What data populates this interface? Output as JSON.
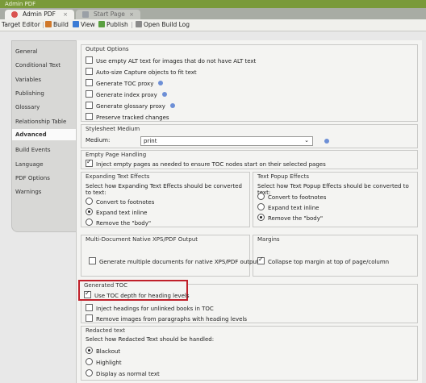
{
  "window": {
    "title": "Admin PDF"
  },
  "tabs": [
    {
      "label": "Admin PDF",
      "close": "×",
      "color": "#d9534f"
    },
    {
      "label": "Start Page",
      "close": "×",
      "color": "#9aa0a6"
    }
  ],
  "toolbar": {
    "target_editor": "Target Editor",
    "build": "Build",
    "view": "View",
    "publish": "Publish",
    "open_build_log": "Open Build Log"
  },
  "nav": {
    "items": [
      "General",
      "Conditional Text",
      "Variables",
      "Publishing",
      "Glossary",
      "Relationship Table",
      "Advanced",
      "Build Events",
      "Language",
      "PDF Options",
      "Warnings"
    ],
    "selected": "Advanced"
  },
  "output_options": {
    "title": "Output Options",
    "items": [
      {
        "label": "Use empty ALT text for images that do not have ALT text",
        "checked": false,
        "info": false
      },
      {
        "label": "Auto-size Capture objects to fit text",
        "checked": false,
        "info": false
      },
      {
        "label": "Generate TOC proxy",
        "checked": false,
        "info": true
      },
      {
        "label": "Generate index proxy",
        "checked": false,
        "info": true
      },
      {
        "label": "Generate glossary proxy",
        "checked": false,
        "info": true
      },
      {
        "label": "Preserve tracked changes",
        "checked": false,
        "info": false
      }
    ]
  },
  "stylesheet_medium": {
    "title": "Stylesheet Medium",
    "label": "Medium:",
    "value": "print",
    "arrow": "⌄"
  },
  "empty_page": {
    "title": "Empty Page Handling",
    "label": "Inject empty pages as needed to ensure TOC nodes start on their selected pages",
    "checked": true
  },
  "expanding_text": {
    "title": "Expanding Text Effects",
    "prompt": "Select how Expanding Text Effects should be converted to text:",
    "options": [
      "Convert to footnotes",
      "Expand text inline",
      "Remove the \"body\""
    ],
    "selected": 1
  },
  "popup_text": {
    "title": "Text Popup Effects",
    "prompt": "Select how Text Popup Effects should be converted to text:",
    "options": [
      "Convert to footnotes",
      "Expand text inline",
      "Remove the \"body\""
    ],
    "selected": 2
  },
  "multidoc": {
    "title": "Multi-Document Native XPS/PDF Output",
    "label": "Generate multiple documents for native XPS/PDF output",
    "checked": false
  },
  "margins": {
    "title": "Margins",
    "label": "Collapse top margin at top of page/column",
    "checked": true
  },
  "generated_toc": {
    "title": "Generated TOC",
    "items": [
      {
        "label": "Use TOC depth for heading levels",
        "checked": true
      },
      {
        "label": "Inject headings for unlinked books in TOC",
        "checked": false
      },
      {
        "label": "Remove images from paragraphs with heading levels",
        "checked": false
      }
    ]
  },
  "redacted": {
    "title": "Redacted text",
    "prompt": "Select how Redacted Text should be handled:",
    "options": [
      "Blackout",
      "Highlight",
      "Display as normal text"
    ],
    "selected": 0
  }
}
